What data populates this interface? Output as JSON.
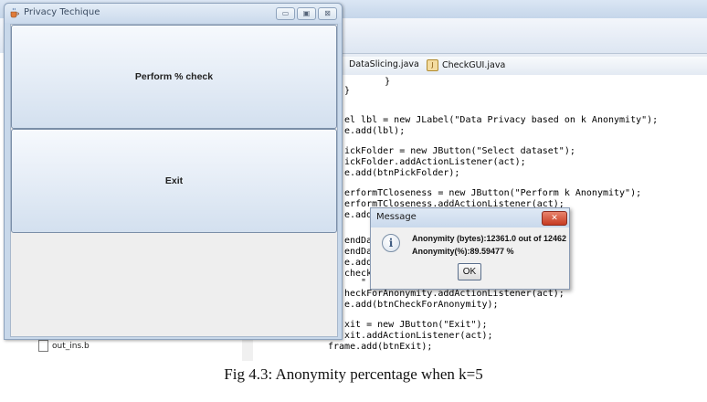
{
  "ide": {
    "tabs": [
      "DataSlicing.java",
      "CheckGUI.java"
    ],
    "sidebar_files": [
      "out_ins.b"
    ],
    "code_lines": [
      "    }",
      "}",
      "el lbl = new JLabel(\"Data Privacy based on k Anonymity\");",
      "e.add(lbl);",
      "ickFolder = new JButton(\"Select dataset\");",
      "ickFolder.addActionListener(act);",
      "e.add(btnPickFolder);",
      "erformTCloseness = new JButton(\"Perform k Anonymity\");",
      "erformTCloseness.addActionListener(act);",
      "e.add",
      "endDa",
      "endDa",
      "e.add",
      "checkF",
      "   \"",
      "heckForAnonymity.addActionListener(act);",
      "e.add(btnCheckForAnonymity);",
      "xit = new JButton(\"Exit\");",
      "xit.addActionListener(act);",
      "frame.add(btnExit);"
    ]
  },
  "privacy_window": {
    "title": "Privacy Techique",
    "perform_button_label": "Perform % check",
    "exit_button_label": "Exit",
    "window_controls": [
      "minimize",
      "maximize",
      "close"
    ]
  },
  "message_dialog": {
    "title": "Message",
    "line1": "Anonymity (bytes):12361.0 out of 12462",
    "line2": "Anonymity(%):89.59477 %",
    "ok_label": "OK",
    "close_glyph": "✕",
    "info_glyph": "i"
  },
  "caption": "Fig 4.3: Anonymity percentage when k=5"
}
